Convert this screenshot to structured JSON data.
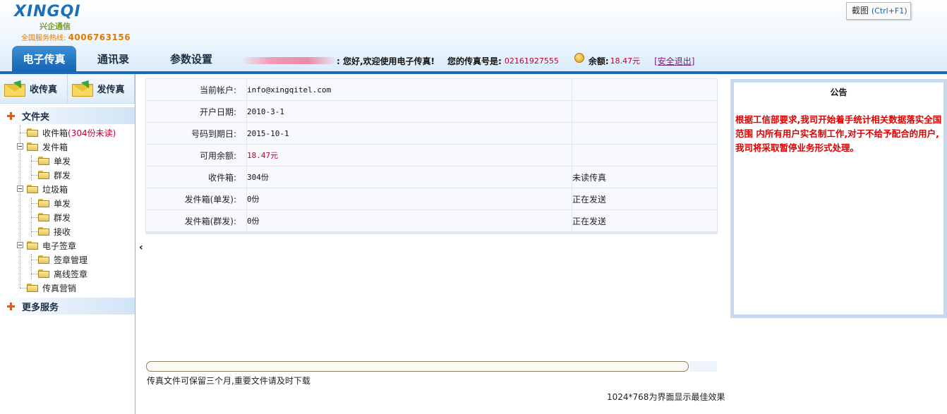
{
  "brand": {
    "name": "XINGQI",
    "cn_name": "兴企通信",
    "hotline_label": "全国服务热线:",
    "hotline_number": "4006763156"
  },
  "screenshot_tip": {
    "label": "截图",
    "shortcut": "(Ctrl+F1)"
  },
  "nav": {
    "tabs": [
      {
        "label": "电子传真",
        "active": true
      },
      {
        "label": "通讯录",
        "active": false
      },
      {
        "label": "参数设置",
        "active": false
      }
    ]
  },
  "userbar": {
    "greeting": ": 您好,欢迎使用电子传真!",
    "fax_label": "您的传真号是:",
    "fax_number": "02161927555",
    "balance_label": "余额:",
    "balance_value": "18.47元",
    "logout": "[安全退出]"
  },
  "sidebar": {
    "receive_btn": "收传真",
    "send_btn": "发传真",
    "folders_title": "文件夹",
    "inbox": {
      "label": "收件箱",
      "unread": "(304份未读)"
    },
    "outbox": {
      "label": "发件箱",
      "children": [
        "单发",
        "群发"
      ]
    },
    "trash": {
      "label": "垃圾箱",
      "children": [
        "单发",
        "群发",
        "接收"
      ]
    },
    "esign": {
      "label": "电子签章",
      "children": [
        "签章管理",
        "离线签章"
      ]
    },
    "marketing": {
      "label": "传真营销"
    },
    "more_services": "更多服务"
  },
  "account": {
    "rows": [
      {
        "label": "当前帐户:",
        "value": "info@xingqitel.com",
        "extra": ""
      },
      {
        "label": "开户日期:",
        "value": "2010-3-1",
        "extra": ""
      },
      {
        "label": "号码到期日:",
        "value": "2015-10-1",
        "extra": ""
      },
      {
        "label": "可用余额:",
        "value": "18.47元",
        "extra": ""
      },
      {
        "label": "收件箱:",
        "value": "304份",
        "extra": "未读传真"
      },
      {
        "label": "发件箱(单发):",
        "value": "0份",
        "extra": "正在发送"
      },
      {
        "label": "发件箱(群发):",
        "value": "0份",
        "extra": "正在发送"
      }
    ]
  },
  "footer": {
    "keep_notice": "传真文件可保留三个月,重要文件请及时下载",
    "best_display": "1024*768为界面显示最佳效果"
  },
  "announcement": {
    "title": "公告",
    "body": "根据工信部要求,我司开始着手统计相关数据落实全国范围 内所有用户实名制工作,对于不给予配合的用户,我司将采取暂停业务形式处理。"
  },
  "colors": {
    "nav_active": "#1e70bf",
    "accent_red": "#c00030",
    "announcement_text": "#dd0000"
  }
}
